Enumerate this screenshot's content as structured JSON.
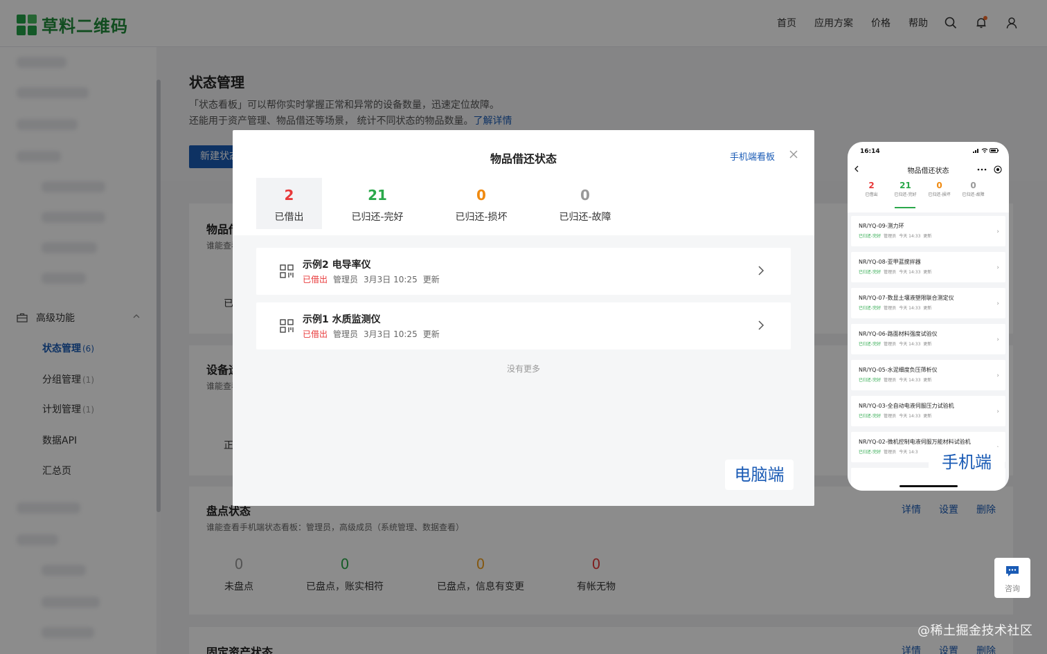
{
  "brand": {
    "name": "草料二维码"
  },
  "nav": {
    "home": "首页",
    "solutions": "应用方案",
    "pricing": "价格",
    "help": "帮助"
  },
  "sidebar": {
    "advanced": "高级功能",
    "items": [
      {
        "label": "状态管理",
        "count": "(6)"
      },
      {
        "label": "分组管理",
        "count": "(1)"
      },
      {
        "label": "计划管理",
        "count": "(1)"
      },
      {
        "label": "数据API",
        "count": ""
      },
      {
        "label": "汇总页",
        "count": ""
      }
    ]
  },
  "main": {
    "title": "状态管理",
    "desc1": "「状态看板」可以帮你实时掌握正常和异常的设备数量，迅速定位故障。",
    "desc2": "还能用于资产管理、物品借还等场景， 统计不同状态的物品数量。",
    "desc_link": "了解详情",
    "new_button": "新建状态",
    "card1": {
      "title": "物品借还状态",
      "sub": "谁能查看手机端状态看板",
      "stat_label": "已借出"
    },
    "card2": {
      "title": "设备运行状态",
      "sub": "谁能查看手机端状态看板",
      "stat_label": "正常"
    },
    "card3": {
      "title": "盘点状态",
      "sub": "谁能查看手机端状态看板：管理员，高级成员（系统管理、数据查看）",
      "stats": [
        {
          "value": "0",
          "label": "未盘点",
          "color": "#999999"
        },
        {
          "value": "0",
          "label": "已盘点，账实相符",
          "color": "#2aa84a"
        },
        {
          "value": "0",
          "label": "已盘点，信息有变更",
          "color": "#f0a020"
        },
        {
          "value": "0",
          "label": "有帐无物",
          "color": "#e8393a"
        }
      ]
    },
    "card4": {
      "title": "固定资产状态"
    },
    "actions": {
      "detail": "详情",
      "settings": "设置",
      "delete": "删除"
    }
  },
  "modal": {
    "title": "物品借还状态",
    "mobile_link": "手机端看板",
    "tabs": [
      {
        "value": "2",
        "label": "已借出",
        "color": "#e8393a"
      },
      {
        "value": "21",
        "label": "已归还-完好",
        "color": "#2aa84a"
      },
      {
        "value": "0",
        "label": "已归还-损坏",
        "color": "#f08a10"
      },
      {
        "value": "0",
        "label": "已归还-故障",
        "color": "#999999"
      }
    ],
    "items": [
      {
        "name": "示例2 电导率仪",
        "status": "已借出",
        "user": "管理员",
        "time": "3月3日 10:25",
        "action": "更新"
      },
      {
        "name": "示例1 水质监测仪",
        "status": "已借出",
        "user": "管理员",
        "time": "3月3日 10:25",
        "action": "更新"
      }
    ],
    "no_more": "没有更多",
    "pc_label": "电脑端"
  },
  "phone": {
    "time": "16:14",
    "title": "物品借还状态",
    "tabs": [
      {
        "value": "2",
        "label": "已借出",
        "color": "#e8393a"
      },
      {
        "value": "21",
        "label": "已归还-完好",
        "color": "#2aa84a"
      },
      {
        "value": "0",
        "label": "已归还-损坏",
        "color": "#f08a10"
      },
      {
        "value": "0",
        "label": "已归还-故障",
        "color": "#999999"
      }
    ],
    "items": [
      {
        "name": "NR/YQ-09-测力环",
        "status": "已归还-完好",
        "user": "管理员",
        "time": "今天 14:33",
        "action": "更新"
      },
      {
        "name": "NR/YQ-08-亚甲蓝搅拌器",
        "status": "已归还-完好",
        "user": "管理员",
        "time": "今天 14:33",
        "action": "更新"
      },
      {
        "name": "NR/YQ-07-数显土壤液塑限联合测定仪",
        "status": "已归还-完好",
        "user": "管理员",
        "time": "今天 14:33",
        "action": "更新"
      },
      {
        "name": "NR/YQ-06-路面材料强度试验仪",
        "status": "已归还-完好",
        "user": "管理员",
        "time": "今天 14:33",
        "action": "更新"
      },
      {
        "name": "NR/YQ-05-水泥细度负压筛析仪",
        "status": "已归还-完好",
        "user": "管理员",
        "time": "今天 14:33",
        "action": "更新"
      },
      {
        "name": "NR/YQ-03-全自动电液伺服压力试验机",
        "status": "已归还-完好",
        "user": "管理员",
        "time": "今天 14:33",
        "action": "更新"
      },
      {
        "name": "NR/YQ-02-微机控制电液伺服万能材料试验机",
        "status": "已归还-完好",
        "user": "管理员",
        "time": "今天 14:3",
        "action": ""
      }
    ],
    "mobile_label": "手机端"
  },
  "consult": {
    "label": "咨询"
  },
  "watermark": "@稀土掘金技术社区"
}
